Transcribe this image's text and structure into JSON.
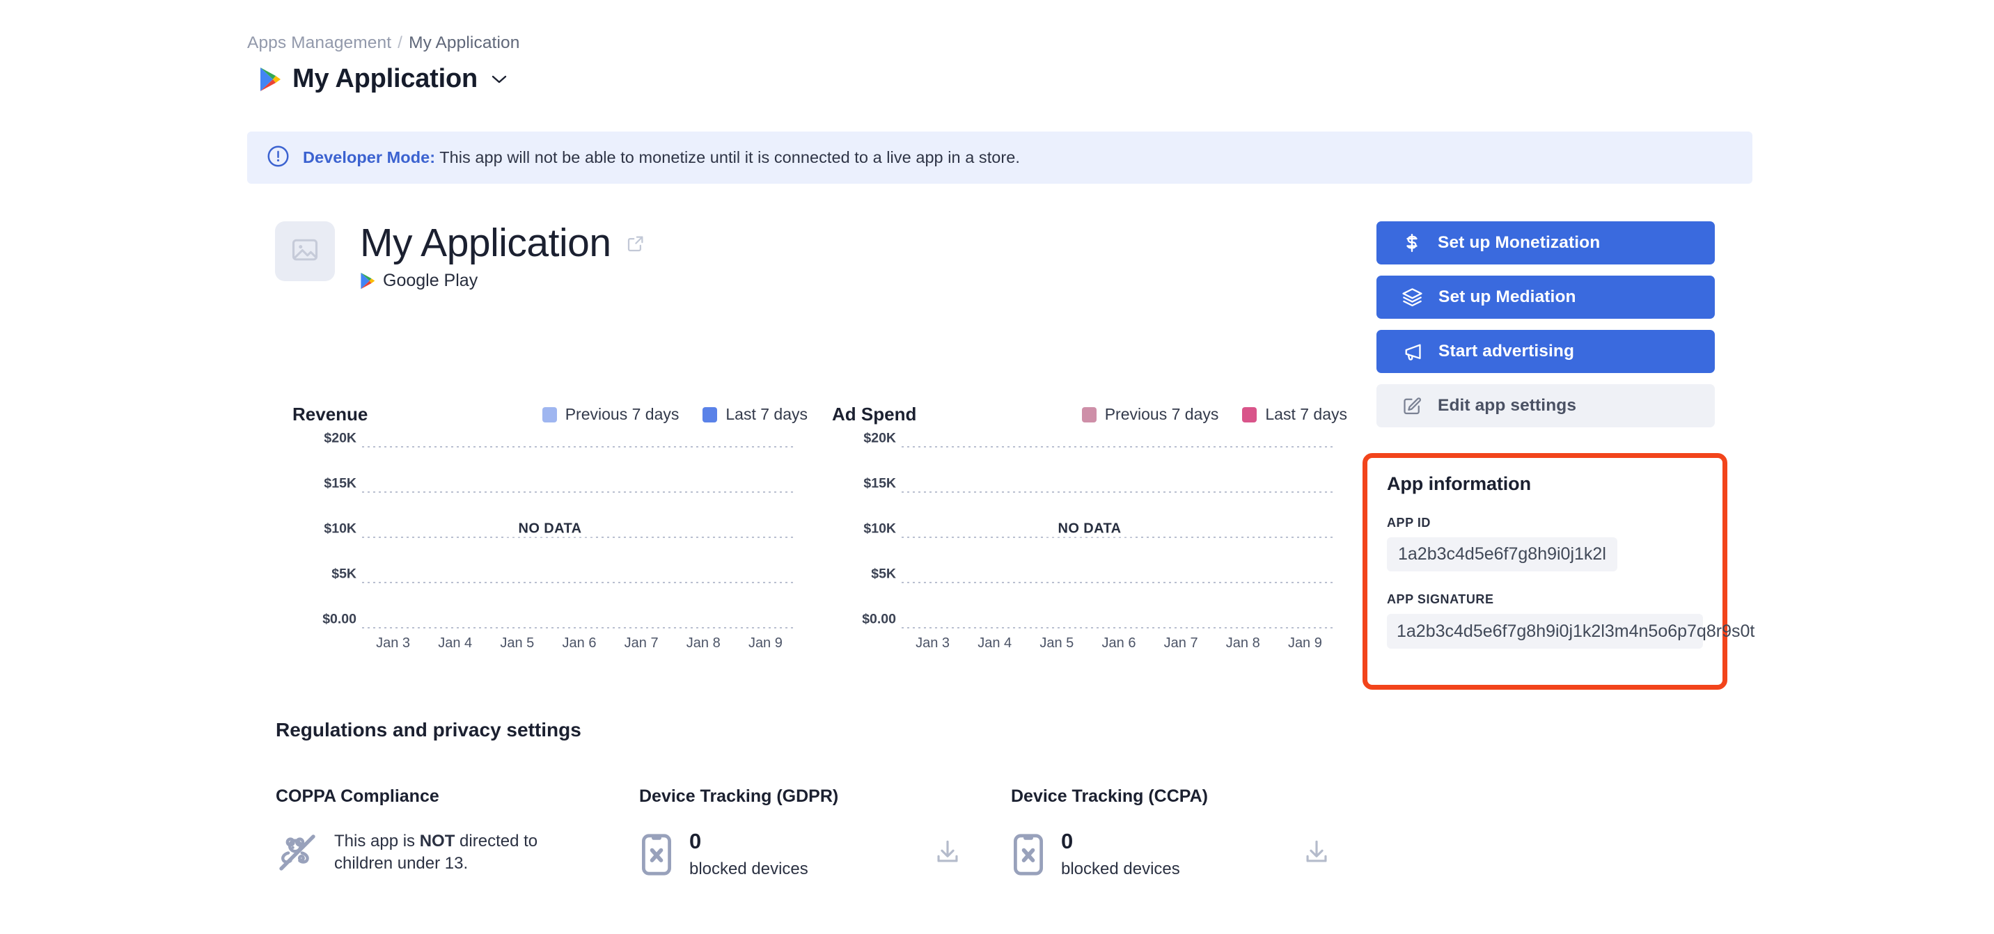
{
  "breadcrumb": {
    "parent": "Apps Management",
    "separator": "/",
    "current": "My Application"
  },
  "header": {
    "title": "My Application",
    "store_icon": "google-play-icon",
    "dropdown_icon": "chevron-down-icon"
  },
  "banner": {
    "icon": "info-circle-icon",
    "label": "Developer Mode:",
    "message": " This app will not be able to monetize until it is connected to a live app in a store.",
    "bg_color": "#ebf0fd",
    "accent_color": "#3b62d0"
  },
  "app_hero": {
    "thumbnail_icon": "image-placeholder-icon",
    "name": "My Application",
    "external_link_icon": "external-link-icon",
    "store_icon": "google-play-icon",
    "store_name": "Google Play"
  },
  "actions": [
    {
      "label": "Set up Monetization",
      "icon": "dollar-icon",
      "style": "primary"
    },
    {
      "label": "Set up Mediation",
      "icon": "layers-icon",
      "style": "primary"
    },
    {
      "label": "Start advertising",
      "icon": "megaphone-icon",
      "style": "primary"
    },
    {
      "label": "Edit app settings",
      "icon": "pencil-square-icon",
      "style": "secondary"
    }
  ],
  "app_information": {
    "title": "App information",
    "app_id_label": "APP ID",
    "app_id_value": "1a2b3c4d5e6f7g8h9i0j1k2l",
    "app_signature_label": "APP SIGNATURE",
    "app_signature_value": "1a2b3c4d5e6f7g8h9i0j1k2l3m4n5o6p7q8r9s0t",
    "highlight_color": "#f2441b"
  },
  "chart_data": [
    {
      "type": "line",
      "title": "Revenue",
      "xlabel": "",
      "ylabel": "",
      "x": [
        "Jan 3",
        "Jan 4",
        "Jan 5",
        "Jan 6",
        "Jan 7",
        "Jan 8",
        "Jan 9"
      ],
      "yticks": [
        "$0.00",
        "$5K",
        "$10K",
        "$15K",
        "$20K"
      ],
      "ylim": [
        0,
        20000
      ],
      "grid": true,
      "legend_position": "top-right",
      "empty_message": "NO DATA",
      "series": [
        {
          "name": "Previous 7 days",
          "color": "#9fb6f0",
          "values": []
        },
        {
          "name": "Last 7 days",
          "color": "#5a82e8",
          "values": []
        }
      ]
    },
    {
      "type": "line",
      "title": "Ad Spend",
      "xlabel": "",
      "ylabel": "",
      "x": [
        "Jan 3",
        "Jan 4",
        "Jan 5",
        "Jan 6",
        "Jan 7",
        "Jan 8",
        "Jan 9"
      ],
      "yticks": [
        "$0.00",
        "$5K",
        "$10K",
        "$15K",
        "$20K"
      ],
      "ylim": [
        0,
        20000
      ],
      "grid": true,
      "legend_position": "top-right",
      "empty_message": "NO DATA",
      "series": [
        {
          "name": "Previous 7 days",
          "color": "#ce8fa8",
          "values": []
        },
        {
          "name": "Last 7 days",
          "color": "#d9558a",
          "values": []
        }
      ]
    }
  ],
  "regulations": {
    "title": "Regulations and privacy settings",
    "coppa": {
      "title": "COPPA Compliance",
      "icon": "teddy-bear-slash-icon",
      "text_pre": "This app is ",
      "text_bold": "NOT",
      "text_post": " directed to children under 13."
    },
    "gdpr": {
      "title": "Device Tracking (GDPR)",
      "icon": "phone-blocked-icon",
      "count": "0",
      "count_label": "blocked devices",
      "download_icon": "download-icon"
    },
    "ccpa": {
      "title": "Device Tracking (CCPA)",
      "icon": "phone-blocked-icon",
      "count": "0",
      "count_label": "blocked devices",
      "download_icon": "download-icon"
    }
  }
}
